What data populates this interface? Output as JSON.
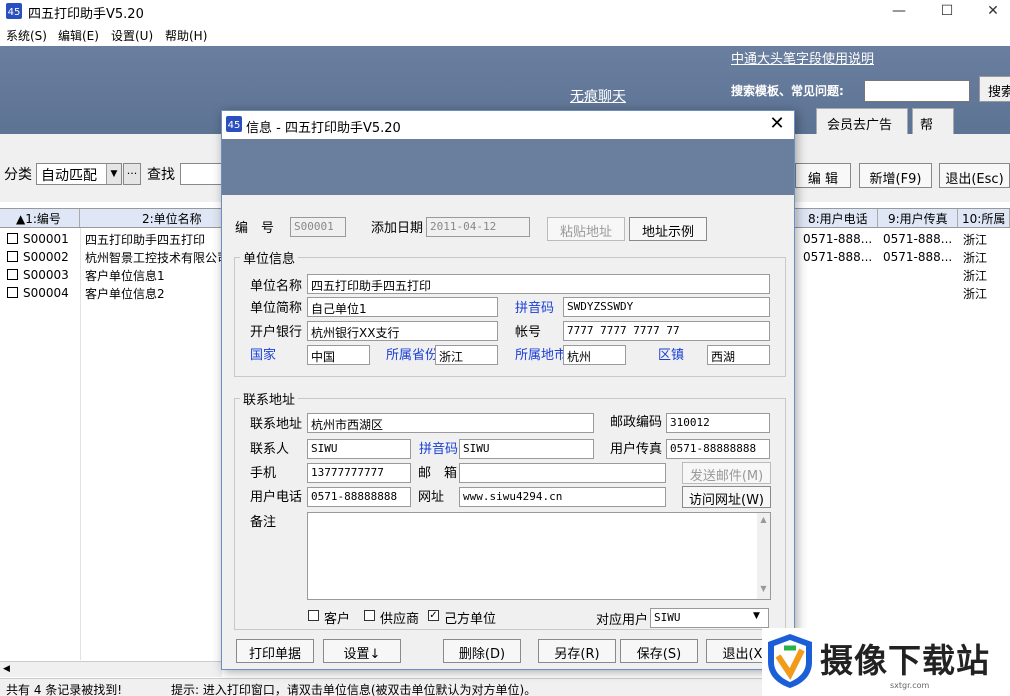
{
  "window": {
    "title": "四五打印助手V5.20"
  },
  "menu": [
    "系统(S)",
    "编辑(E)",
    "设置(U)",
    "帮助(H)"
  ],
  "banner": {
    "chat_link": "无痕聊天",
    "help_link": "中通大头笔字段使用说明",
    "search_label": "搜索模板、常见问题:",
    "search_button": "搜索",
    "tabs": [
      "会员去广告",
      "帮助"
    ]
  },
  "toolbar": {
    "category_label": "分类",
    "category_value": "自动匹配",
    "more_label": "···",
    "find_label": "查找",
    "buttons": [
      "编 辑",
      "新增(F9)",
      "退出(Esc)"
    ]
  },
  "table": {
    "headers": [
      "▲1:编号",
      "2:单位名称",
      "8:用户电话",
      "9:用户传真",
      "10:所属"
    ],
    "rows": [
      {
        "id": "S00001",
        "name": "四五打印助手四五打印",
        "phone": "0571-888...",
        "fax": "0571-888...",
        "prov": "浙江"
      },
      {
        "id": "S00002",
        "name": "杭州智景工控技术有限公司",
        "phone": "0571-888...",
        "fax": "0571-888...",
        "prov": "浙江"
      },
      {
        "id": "S00003",
        "name": "客户单位信息1",
        "phone": "",
        "fax": "",
        "prov": "浙江"
      },
      {
        "id": "S00004",
        "name": "客户单位信息2",
        "phone": "",
        "fax": "",
        "prov": "浙江"
      }
    ]
  },
  "status": {
    "left": "共有 4 条记录被找到!",
    "hint": "提示: 进入打印窗口，请双击单位信息(被双击单位默认为对方单位)。"
  },
  "dialog": {
    "title": "信息 - 四五打印助手V5.20",
    "id_label": "编　号",
    "id_value": "S00001",
    "date_label": "添加日期",
    "date_value": "2011-04-12",
    "paste_button": "粘贴地址",
    "example_button": "地址示例",
    "unit_group": "单位信息",
    "unit_name_label": "单位名称",
    "unit_name": "四五打印助手四五打印",
    "short_label": "单位简称",
    "short_name": "自己单位1",
    "pinyin_label": "拼音码",
    "pinyin": "SWDYZSSWDY",
    "bank_label": "开户银行",
    "bank": "杭州银行XX支行",
    "account_label": "帐号",
    "account": "7777 7777 7777 77",
    "country_label": "国家",
    "country": "中国",
    "province_label": "所属省份",
    "province": "浙江",
    "city_label": "所属地市",
    "city": "杭州",
    "district_label": "区镇",
    "district": "西湖",
    "contact_group": "联系地址",
    "address_label": "联系地址",
    "address": "杭州市西湖区",
    "zip_label": "邮政编码",
    "zip": "310012",
    "person_label": "联系人",
    "person": "SIWU",
    "person_pinyin_label": "拼音码",
    "person_pinyin": "SIWU",
    "fax_label": "用户传真",
    "fax": "0571-88888888",
    "mobile_label": "手机",
    "mobile": "13777777777",
    "email_label": "邮　箱",
    "email": "",
    "send_mail_button": "发送邮件(M)",
    "phone_label": "用户电话",
    "phone": "0571-88888888",
    "web_label": "网址",
    "web": "www.siwu4294.cn",
    "visit_button": "访问网址(W)",
    "notes_label": "备注",
    "notes": "",
    "cb_customer": "客户",
    "cb_supplier": "供应商",
    "cb_own": "己方单位",
    "own_checked": true,
    "user_label": "对应用户",
    "user_value": "SIWU",
    "buttons": [
      "打印单据",
      "设置↓",
      "删除(D)",
      "另存(R)",
      "保存(S)",
      "退出(X)"
    ]
  },
  "watermark": {
    "text": "摄像下载站",
    "sub": "sxtgr.com"
  },
  "colors": {
    "banner": "#6a7f9e",
    "link_blue": "#1a3fd8"
  }
}
